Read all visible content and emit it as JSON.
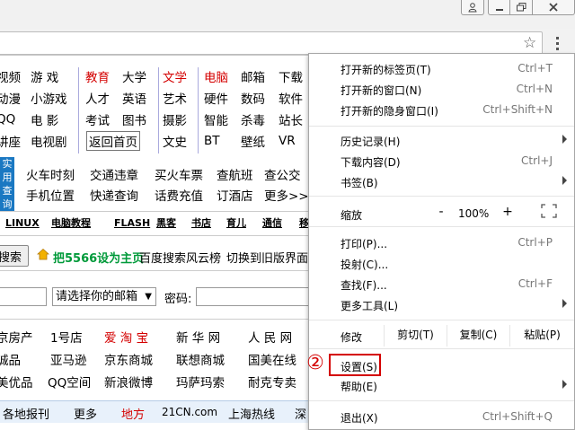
{
  "window": {
    "user_icon": "user-icon",
    "minimize_icon": "minimize-icon",
    "maximize_icon": "maximize-icon",
    "close_icon": "close-icon"
  },
  "toolbar": {
    "bookmark_icon": "☆",
    "menu_icon": "menu-icon"
  },
  "page": {
    "nav_rows": [
      [
        "视频",
        "游  戏",
        "教育",
        "大学",
        "文学",
        "电脑",
        "邮箱",
        "下载"
      ],
      [
        "动漫",
        "小游戏",
        "人才",
        "英语",
        "艺术",
        "硬件",
        "数码",
        "软件"
      ],
      [
        "QQ",
        "电  影",
        "考试",
        "图书",
        "摄影",
        "智能",
        "杀毒",
        "站长"
      ],
      [
        "讲座",
        "电视剧",
        "返回首页",
        "",
        "文史",
        "BT",
        "壁纸",
        "VR"
      ]
    ],
    "practical_badge": "实用查询",
    "practical_row1": [
      "火车时刻",
      "交通违章",
      "买火车票",
      "查航班",
      "查公交"
    ],
    "practical_row2": [
      "手机位置",
      "快递查询",
      "话费充值",
      "订酒店",
      "更多>>"
    ],
    "tech_links": [
      "LINUX",
      "电脑教程",
      "FLASH",
      "黑客",
      "书店",
      "育儿",
      "通信",
      "移"
    ],
    "search_button": "搜索",
    "set_homepage": "把5566设为主页",
    "baidu_cloud": "百度搜索风云榜",
    "old_version": "切换到旧版界面",
    "email_select": "请选择你的邮箱",
    "password_label": "密码:",
    "site_rows": [
      [
        "京房产",
        "1号店",
        "爱 淘 宝",
        "新 华 网",
        "人 民 网"
      ],
      [
        "诚品",
        "亚马逊",
        "京东商城",
        "联想商城",
        "国美在线"
      ],
      [
        "美优品",
        "QQ空间",
        "新浪微博",
        "玛萨玛索",
        "耐克专卖"
      ]
    ],
    "bottom_links": [
      "各地报刊",
      "更多",
      "地方",
      "21CN.com",
      "上海热线",
      "深"
    ]
  },
  "menu": {
    "new_tab": "打开新的标签页(T)",
    "new_tab_shortcut": "Ctrl+T",
    "new_window": "打开新的窗口(N)",
    "new_window_shortcut": "Ctrl+N",
    "incognito": "打开新的隐身窗口(I)",
    "incognito_shortcut": "Ctrl+Shift+N",
    "history": "历史记录(H)",
    "downloads": "下载内容(D)",
    "downloads_shortcut": "Ctrl+J",
    "bookmarks": "书签(B)",
    "zoom_label": "缩放",
    "zoom_minus": "-",
    "zoom_value": "100%",
    "zoom_plus": "+",
    "print": "打印(P)...",
    "print_shortcut": "Ctrl+P",
    "cast": "投射(C)...",
    "find": "查找(F)...",
    "find_shortcut": "Ctrl+F",
    "more_tools": "更多工具(L)",
    "edit_label": "修改",
    "cut": "剪切(T)",
    "copy": "复制(C)",
    "paste": "粘贴(P)",
    "settings": "设置(S)",
    "help": "帮助(E)",
    "exit": "退出(X)",
    "exit_shortcut": "Ctrl+Shift+Q"
  },
  "annotation": {
    "marker": "②",
    "color": "#d40000"
  }
}
